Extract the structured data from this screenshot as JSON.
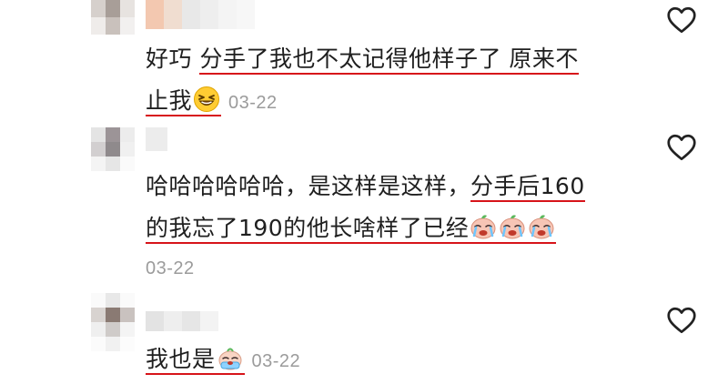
{
  "comments": [
    {
      "text_plain": "好巧 ",
      "text_underlined_1": "分手了我也不太记得他样子了 原来不",
      "text_underlined_2": "止我",
      "emoji": "laughing-squint-emoji",
      "timestamp": "03-22",
      "like_icon": "heart-outline-icon"
    },
    {
      "text_plain": "哈哈哈哈哈哈，是这样是这样，",
      "text_underlined_1": "分手后160",
      "text_underlined_2": "的我忘了190的他长啥样了已经",
      "emoji": "crying-peach-emoji",
      "emoji_count": 3,
      "timestamp": "03-22",
      "like_icon": "heart-outline-icon"
    },
    {
      "text_underlined": "我也是",
      "emoji": "crying-baby-emoji",
      "timestamp": "03-22",
      "like_icon": "heart-outline-icon"
    }
  ],
  "colors": {
    "text": "#1f1f1f",
    "timestamp": "#9b9b9b",
    "underline": "#d7141a",
    "icon": "#222222"
  }
}
